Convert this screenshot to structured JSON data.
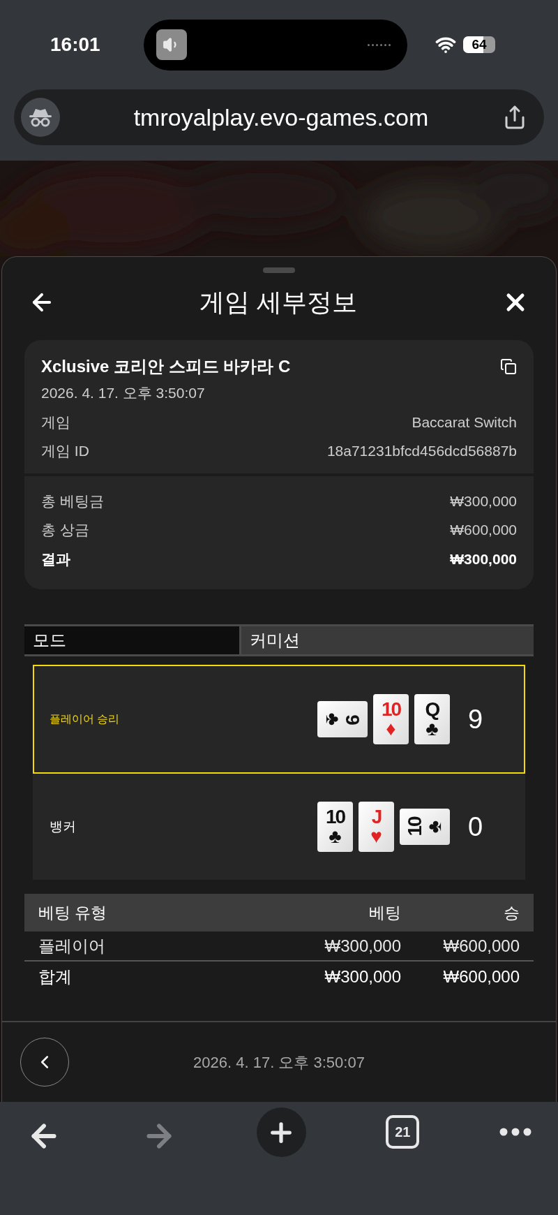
{
  "status_bar": {
    "time": "16:01",
    "battery": "64"
  },
  "browser": {
    "url": "tmroyalplay.evo-games.com",
    "tab_count": "21",
    "forward_disabled": true
  },
  "sheet": {
    "title": "게임 세부정보"
  },
  "game": {
    "name": "Xclusive 코리안 스피드 바카라 C",
    "date": "2026. 4. 17. 오후 3:50:07",
    "details": [
      {
        "label": "게임",
        "value": "Baccarat Switch"
      },
      {
        "label": "게임 ID",
        "value": "18a71231bfcd456dcd56887b"
      }
    ],
    "totals": [
      {
        "label": "총 베팅금",
        "value": "₩300,000",
        "bold": false
      },
      {
        "label": "총 상금",
        "value": "₩600,000",
        "bold": false
      },
      {
        "label": "결과",
        "value": "₩300,000",
        "bold": true
      }
    ]
  },
  "mode": {
    "label": "모드",
    "value": "커미션"
  },
  "hands": [
    {
      "label": "플레이어 승리",
      "winner": true,
      "score": "9",
      "cards": [
        {
          "kind": "clockwise",
          "rank": "9",
          "suit": "♣",
          "color": "#111111"
        },
        {
          "kind": "upright",
          "rank": "10",
          "suit": "♦",
          "color": "#e02424"
        },
        {
          "kind": "upright",
          "rank": "Q",
          "suit": "♣",
          "color": "#111111"
        }
      ]
    },
    {
      "label": "뱅커",
      "winner": false,
      "score": "0",
      "cards": [
        {
          "kind": "upright",
          "rank": "10",
          "suit": "♣",
          "color": "#111111"
        },
        {
          "kind": "upright",
          "rank": "J",
          "suit": "♥",
          "color": "#e02424"
        },
        {
          "kind": "counterclockwise",
          "rank": "10",
          "suit": "♣",
          "color": "#111111"
        }
      ]
    }
  ],
  "bets": {
    "columns": [
      "베팅 유형",
      "베팅",
      "승"
    ],
    "rows": [
      [
        "플레이어",
        "₩300,000",
        "₩600,000"
      ]
    ],
    "total": [
      "합계",
      "₩300,000",
      "₩600,000"
    ]
  },
  "footer": {
    "date": "2026. 4. 17. 오후 3:50:07"
  }
}
